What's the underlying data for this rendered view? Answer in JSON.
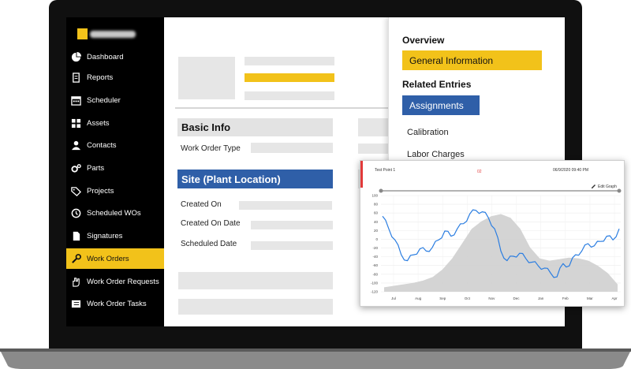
{
  "sidebar": {
    "items": [
      {
        "label": "Dashboard",
        "icon": "pie-chart-icon"
      },
      {
        "label": "Reports",
        "icon": "document-icon"
      },
      {
        "label": "Scheduler",
        "icon": "calendar-icon"
      },
      {
        "label": "Assets",
        "icon": "grid-icon"
      },
      {
        "label": "Contacts",
        "icon": "person-icon"
      },
      {
        "label": "Parts",
        "icon": "gears-icon"
      },
      {
        "label": "Projects",
        "icon": "tag-icon"
      },
      {
        "label": "Scheduled WOs",
        "icon": "clock-icon"
      },
      {
        "label": "Signatures",
        "icon": "page-icon"
      },
      {
        "label": "Work Orders",
        "icon": "wrench-icon",
        "active": true
      },
      {
        "label": "Work Order Requests",
        "icon": "hand-icon"
      },
      {
        "label": "Work Order Tasks",
        "icon": "tasks-icon"
      }
    ]
  },
  "form": {
    "basic_info": "Basic Info",
    "work_order_type": "Work Order Type",
    "site": "Site (Plant Location)",
    "created_on": "Created On",
    "created_on_date": "Created On Date",
    "scheduled_date": "Scheduled Date"
  },
  "overview": {
    "heading": "Overview",
    "general_information": "General Information",
    "related_heading": "Related Entries",
    "assignments": "Assignments",
    "calibration": "Calibration",
    "labor_charges": "Labor Charges"
  },
  "colors": {
    "accent_yellow": "#f2c21a",
    "accent_blue": "#2f5fa8",
    "sidebar_bg": "#000000",
    "line_blue": "#2a7de1",
    "area_gray": "#cfcfcf"
  },
  "chart_data": {
    "type": "line",
    "title": "Test Point 1",
    "center_label": "02",
    "timestamp": "06/9/2020 09:40 PM",
    "edit_label": "Edit Graph",
    "ylim": [
      -30,
      100
    ],
    "y_ticks": [
      "100",
      "80",
      "60",
      "40",
      "20",
      "0",
      "-20",
      "-40",
      "-60",
      "-80",
      "-100",
      "-120"
    ],
    "x_ticks": [
      "Jul",
      "Aug",
      "Sep",
      "Oct",
      "Nov",
      "Dec",
      "Jan",
      "Feb",
      "Mar",
      "Apr"
    ],
    "series": [
      {
        "name": "",
        "kind": "area",
        "values": [
          -24,
          -22,
          -20,
          -18,
          -15,
          -10,
          0,
          15,
          35,
          55,
          65,
          72,
          75,
          70,
          55,
          30,
          15,
          12,
          14,
          16,
          15,
          12,
          5,
          -5,
          -20
        ]
      },
      {
        "name": "",
        "kind": "line",
        "values": [
          72,
          55,
          40,
          20,
          12,
          20,
          28,
          25,
          30,
          40,
          52,
          45,
          55,
          62,
          75,
          80,
          78,
          70,
          55,
          25,
          12,
          18,
          22,
          15,
          10,
          5,
          2,
          -5,
          -10,
          8,
          5,
          20,
          25,
          35,
          32,
          38,
          45,
          40,
          55
        ]
      }
    ]
  }
}
